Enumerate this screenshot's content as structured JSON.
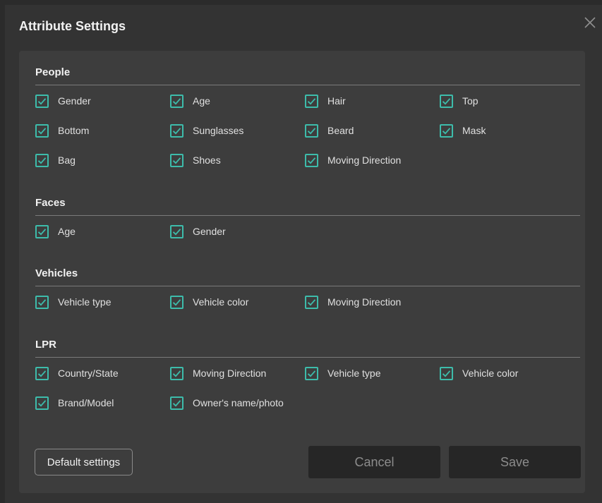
{
  "dialog": {
    "title": "Attribute Settings",
    "close_icon": "close-icon"
  },
  "colors": {
    "checkbox_accent": "#3dbcab",
    "panel_background": "#3d3d3d",
    "dialog_background": "#333333"
  },
  "sections": [
    {
      "title": "People",
      "items": [
        {
          "label": "Gender",
          "checked": true
        },
        {
          "label": "Age",
          "checked": true
        },
        {
          "label": "Hair",
          "checked": true
        },
        {
          "label": "Top",
          "checked": true
        },
        {
          "label": "Bottom",
          "checked": true
        },
        {
          "label": "Sunglasses",
          "checked": true
        },
        {
          "label": "Beard",
          "checked": true
        },
        {
          "label": "Mask",
          "checked": true
        },
        {
          "label": "Bag",
          "checked": true
        },
        {
          "label": "Shoes",
          "checked": true
        },
        {
          "label": "Moving Direction",
          "checked": true
        }
      ]
    },
    {
      "title": "Faces",
      "items": [
        {
          "label": "Age",
          "checked": true
        },
        {
          "label": "Gender",
          "checked": true
        }
      ]
    },
    {
      "title": "Vehicles",
      "items": [
        {
          "label": "Vehicle type",
          "checked": true
        },
        {
          "label": "Vehicle color",
          "checked": true
        },
        {
          "label": "Moving Direction",
          "checked": true
        }
      ]
    },
    {
      "title": "LPR",
      "items": [
        {
          "label": "Country/State",
          "checked": true
        },
        {
          "label": "Moving Direction",
          "checked": true
        },
        {
          "label": "Vehicle type",
          "checked": true
        },
        {
          "label": "Vehicle color",
          "checked": true
        },
        {
          "label": "Brand/Model",
          "checked": true
        },
        {
          "label": "Owner's name/photo",
          "checked": true
        }
      ]
    }
  ],
  "buttons": {
    "default_label": "Default settings",
    "cancel_label": "Cancel",
    "save_label": "Save"
  }
}
